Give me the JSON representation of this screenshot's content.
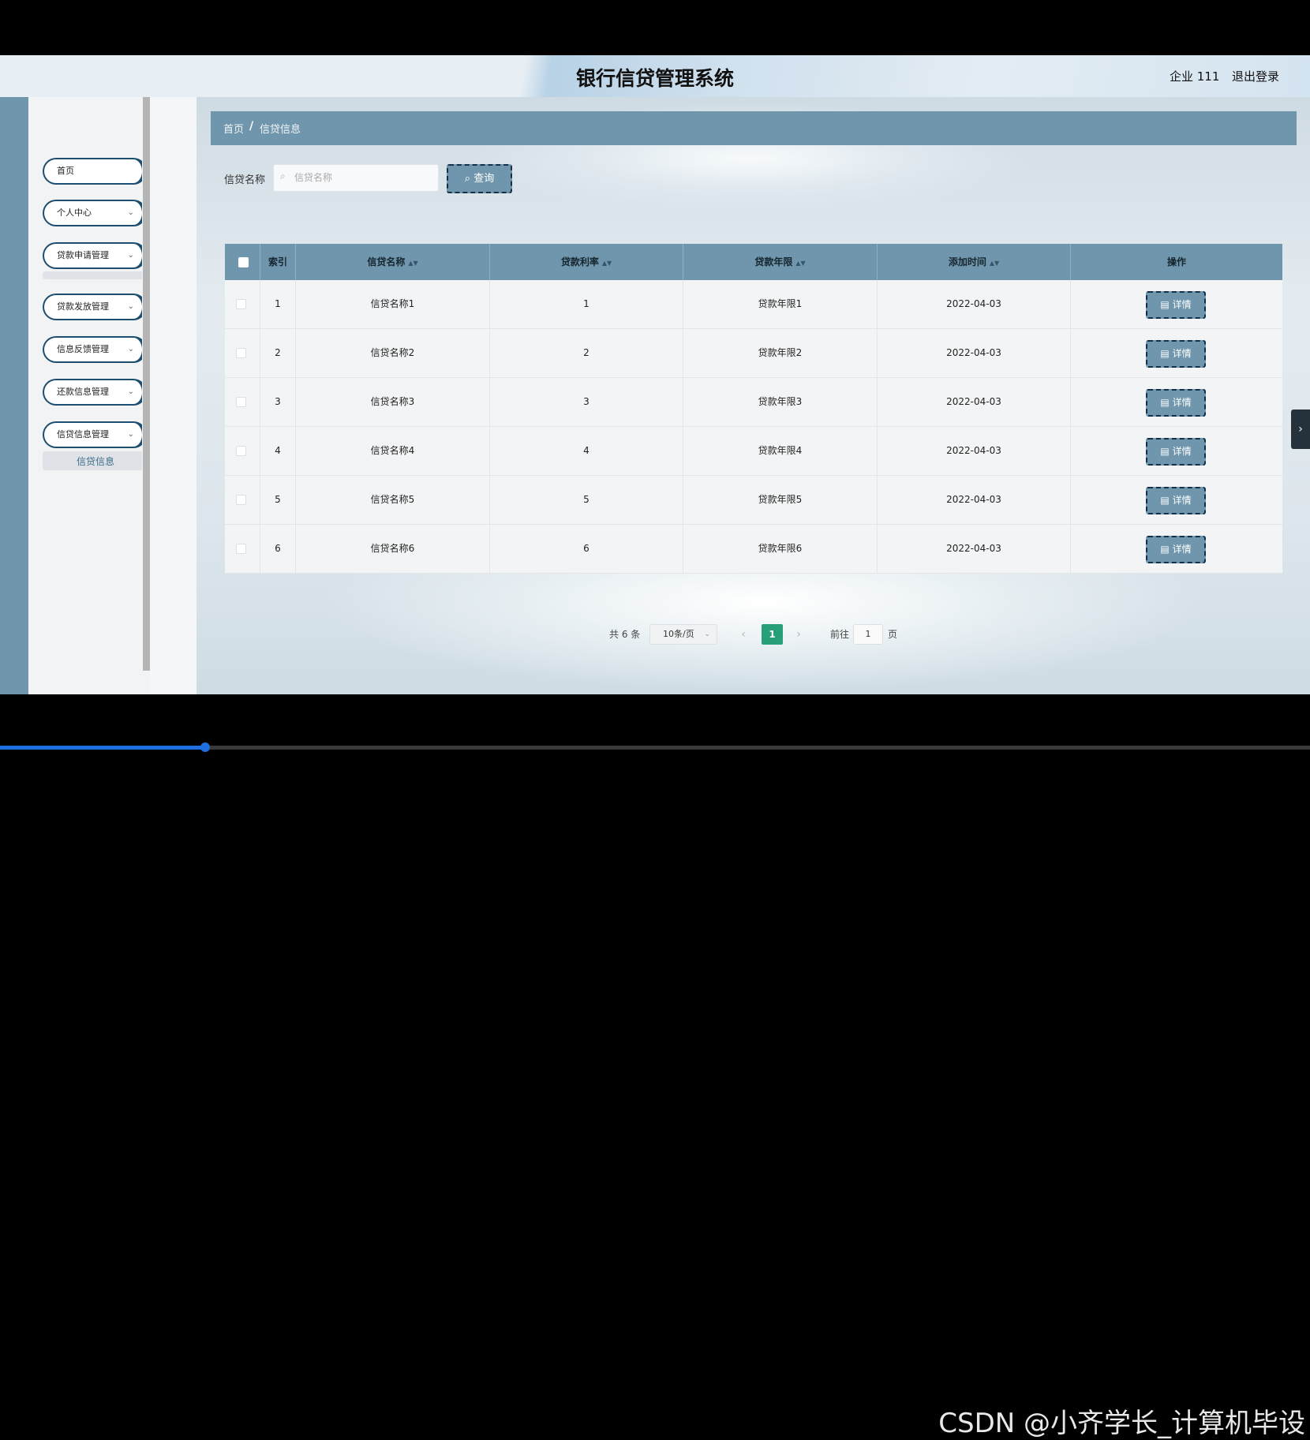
{
  "header": {
    "title": "银行信贷管理系统",
    "user": "企业 111",
    "logout": "退出登录"
  },
  "sidebar": {
    "items": [
      {
        "label": "首页",
        "has_children": false
      },
      {
        "label": "个人中心",
        "has_children": true
      },
      {
        "label": "贷款申请管理",
        "has_children": true
      },
      {
        "label": "贷款发放管理",
        "has_children": true
      },
      {
        "label": "信息反馈管理",
        "has_children": true
      },
      {
        "label": "还款信息管理",
        "has_children": true
      },
      {
        "label": "信贷信息管理",
        "has_children": true
      }
    ],
    "active_sub_item": "信贷信息",
    "chevron": "chevron-down-icon"
  },
  "breadcrumb": {
    "home": "首页",
    "separator": "/",
    "current": "信贷信息"
  },
  "search": {
    "label": "信贷名称",
    "placeholder": "信贷名称",
    "button": "查询"
  },
  "table": {
    "columns": [
      "索引",
      "信贷名称",
      "贷款利率",
      "贷款年限",
      "添加时间",
      "操作"
    ],
    "rows": [
      {
        "index": "1",
        "name": "信贷名称1",
        "rate": "1",
        "term": "贷款年限1",
        "date": "2022-04-03",
        "action": "详情"
      },
      {
        "index": "2",
        "name": "信贷名称2",
        "rate": "2",
        "term": "贷款年限2",
        "date": "2022-04-03",
        "action": "详情"
      },
      {
        "index": "3",
        "name": "信贷名称3",
        "rate": "3",
        "term": "贷款年限3",
        "date": "2022-04-03",
        "action": "详情"
      },
      {
        "index": "4",
        "name": "信贷名称4",
        "rate": "4",
        "term": "贷款年限4",
        "date": "2022-04-03",
        "action": "详情"
      },
      {
        "index": "5",
        "name": "信贷名称5",
        "rate": "5",
        "term": "贷款年限5",
        "date": "2022-04-03",
        "action": "详情"
      },
      {
        "index": "6",
        "name": "信贷名称6",
        "rate": "6",
        "term": "贷款年限6",
        "date": "2022-04-03",
        "action": "详情"
      }
    ]
  },
  "pagination": {
    "total": "共 6 条",
    "page_size": "10条/页",
    "current_page": "1",
    "goto_prefix": "前往",
    "goto_value": "1",
    "goto_suffix": "页"
  },
  "watermark": "CSDN @小齐学长_计算机毕设",
  "colors": {
    "accent": "#6f96ad",
    "dark_border": "#143049",
    "pager_active": "#27a07a"
  }
}
